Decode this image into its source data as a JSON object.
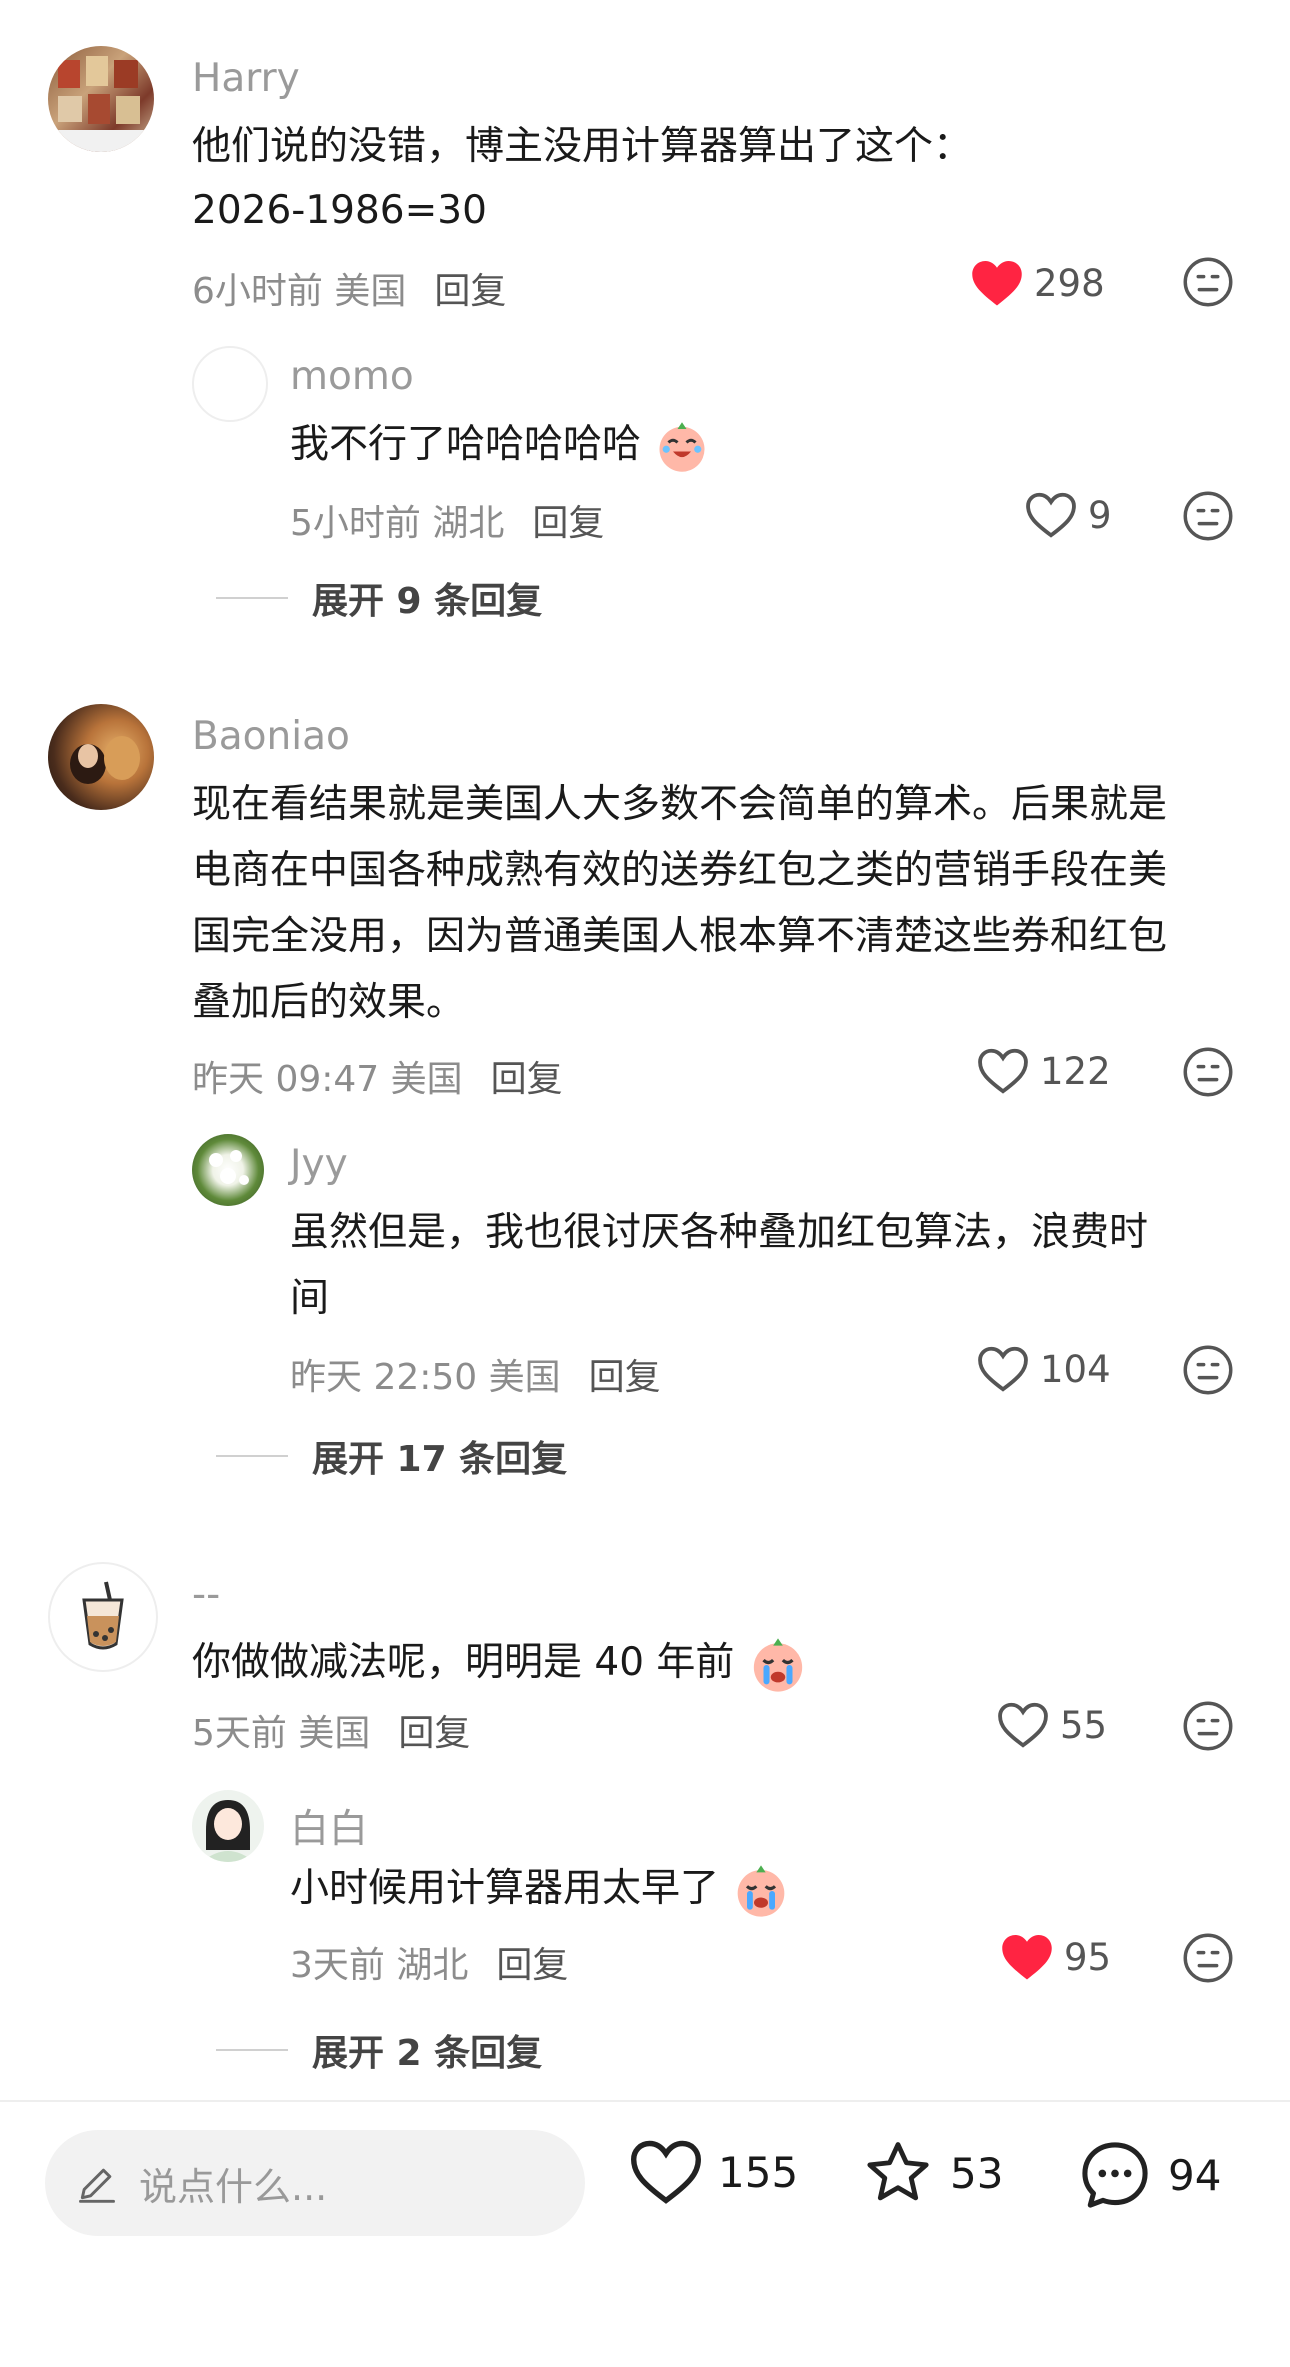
{
  "comments": [
    {
      "username": "Harry",
      "text": [
        "他们说的没错，博主没用计算器算出了这个：",
        "2026-1986=30"
      ],
      "meta": "6小时前 美国",
      "reply_label": "回复",
      "likes": "298",
      "liked": true,
      "replies": [
        {
          "username": "momo",
          "text": "我不行了哈哈哈哈哈",
          "emoji": "crying-laughing-emoji",
          "meta": "5小时前 湖北",
          "reply_label": "回复",
          "likes": "9",
          "liked": false
        }
      ],
      "expand": "展开 9 条回复"
    },
    {
      "username": "Baoniao",
      "text": [
        "现在看结果就是美国人大多数不会简单的算术。后果就是",
        "电商在中国各种成熟有效的送券红包之类的营销手段在美",
        "国完全没用，因为普通美国人根本算不清楚这些券和红包",
        "叠加后的效果。"
      ],
      "meta": "昨天 09:47 美国",
      "reply_label": "回复",
      "likes": "122",
      "liked": false,
      "replies": [
        {
          "username": "Jyy",
          "text": "虽然但是，我也很讨厌各种叠加红包算法，浪费时\n间",
          "meta": "昨天 22:50 美国",
          "reply_label": "回复",
          "likes": "104",
          "liked": false
        }
      ],
      "expand": "展开 17 条回复"
    },
    {
      "username": "--",
      "text": [
        "你做做减法呢，明明是 40 年前"
      ],
      "emoji": "crying-emoji",
      "meta": "5天前 美国",
      "reply_label": "回复",
      "likes": "55",
      "liked": false,
      "replies": [
        {
          "username": "白白",
          "text": "小时候用计算器用太早了",
          "emoji": "crying-emoji",
          "meta": "3天前 湖北",
          "reply_label": "回复",
          "likes": "95",
          "liked": true
        }
      ],
      "expand": "展开 2 条回复"
    }
  ],
  "bottom_bar": {
    "input_placeholder": "说点什么...",
    "likes": "155",
    "favorites": "53",
    "comments": "94"
  },
  "colors": {
    "liked": "#ff2442",
    "meta": "#8c8c8c",
    "username": "#9a9a9a"
  }
}
